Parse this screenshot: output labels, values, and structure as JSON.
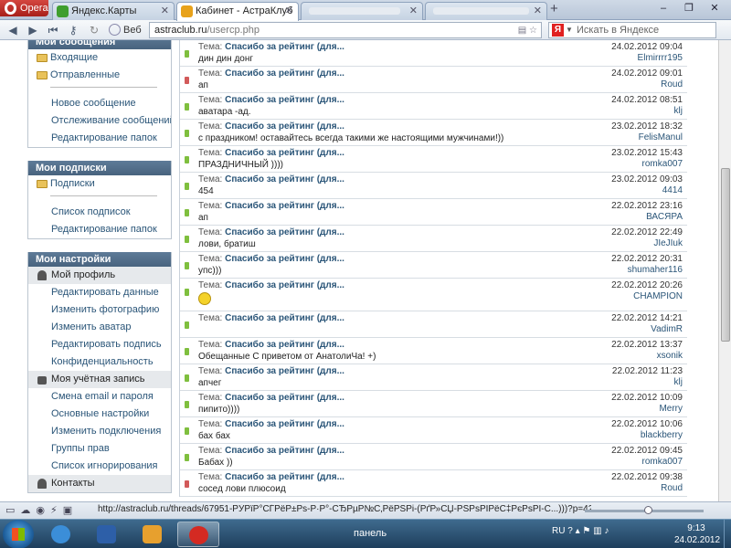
{
  "browser": {
    "menu_label": "Opera",
    "tabs": [
      {
        "title": "Яндекс.Карты",
        "active": false,
        "icon_color": "#3f9e2e"
      },
      {
        "title": "Кабинет - АстраКлуб",
        "active": true,
        "icon_color": "#e8a21a"
      },
      {
        "title": "",
        "active": false,
        "icon_color": ""
      },
      {
        "title": "",
        "active": false,
        "icon_color": ""
      }
    ],
    "window_controls": [
      "–",
      "❐",
      "✕"
    ],
    "address": {
      "prefix": "Веб",
      "domain": "astraclub.ru",
      "path": "/usercp.php"
    },
    "search": {
      "engine": "Я",
      "placeholder": "Искать в Яндексе"
    },
    "status_url": "http://astraclub.ru/threads/67951-РЎРїР°СЃРёР±Рѕ-Р·Р°-СЂРµР№С‚РёРЅРі-(РґР»СЏ-РЅРѕРІРёС‡РєРѕРІ-С...)))?p=4211641#pos..."
  },
  "sidebar": {
    "messages": {
      "title": "Мои сообщения",
      "folders": [
        "Входящие",
        "Отправленные"
      ],
      "links": [
        "Новое сообщение",
        "Отслеживание сообщений",
        "Редактирование папок"
      ]
    },
    "subscriptions": {
      "title": "Мои подписки",
      "folders": [
        "Подписки"
      ],
      "links": [
        "Список подписок",
        "Редактирование папок"
      ]
    },
    "settings": {
      "title": "Мои настройки",
      "profile_head": "Мой профиль",
      "profile_links": [
        "Редактировать данные",
        "Изменить фотографию",
        "Изменить аватар",
        "Редактировать подпись",
        "Конфиденциальность"
      ],
      "account_head": "Моя учётная запись",
      "account_links": [
        "Смена email и пароля",
        "Основные настройки",
        "Изменить подключения",
        "Группы прав",
        "Список игнорирования"
      ],
      "contacts_head": "Контакты"
    }
  },
  "posts": {
    "subject_prefix": "Тема:",
    "subject_title": "Спасибо за рейтинг (для...",
    "rows": [
      {
        "preview": "дин дин донг",
        "date": "24.02.2012 09:04",
        "user": "Elmirrrr195",
        "status": "green"
      },
      {
        "preview": "ап",
        "date": "24.02.2012 09:01",
        "user": "Roud",
        "status": "red"
      },
      {
        "preview": "аватара -ад.",
        "date": "24.02.2012 08:51",
        "user": "klj",
        "status": "green"
      },
      {
        "preview": "с праздником! оставайтесь всегда такими же настоящими мужчинами!))",
        "date": "23.02.2012 18:32",
        "user": "FelisManul",
        "status": "green"
      },
      {
        "preview": "ПРАЗДНИЧНЫЙ ))))",
        "date": "23.02.2012 15:43",
        "user": "romka007",
        "status": "green"
      },
      {
        "preview": "454",
        "date": "23.02.2012 09:03",
        "user": "4414",
        "status": "green"
      },
      {
        "preview": "ап",
        "date": "22.02.2012 23:16",
        "user": "ВАСЯРА",
        "status": "green"
      },
      {
        "preview": "лови, братиш",
        "date": "22.02.2012 22:49",
        "user": "JIeJIuk",
        "status": "green"
      },
      {
        "preview": "упс)))",
        "date": "22.02.2012 20:31",
        "user": "shumaher116",
        "status": "green"
      },
      {
        "preview": "",
        "date": "22.02.2012 20:26",
        "user": "CHAMPION",
        "status": "green",
        "smiley": true
      },
      {
        "preview": "",
        "date": "22.02.2012 14:21",
        "user": "VadimR",
        "status": "green"
      },
      {
        "preview": "Обещанные С приветом от АнатолиЧа! +)",
        "date": "22.02.2012 13:37",
        "user": "xsonik",
        "status": "green"
      },
      {
        "preview": "апчег",
        "date": "22.02.2012 11:23",
        "user": "klj",
        "status": "green"
      },
      {
        "preview": "пипито))))",
        "date": "22.02.2012 10:09",
        "user": "Merry",
        "status": "green"
      },
      {
        "preview": "бах бах",
        "date": "22.02.2012 10:06",
        "user": "blackberry",
        "status": "green"
      },
      {
        "preview": "Бабах ))",
        "date": "22.02.2012 09:45",
        "user": "romka007",
        "status": "green"
      },
      {
        "preview": "сосед лови плюсоид",
        "date": "22.02.2012 09:38",
        "user": "Roud",
        "status": "red"
      }
    ]
  },
  "taskbar": {
    "panel_label": "панель",
    "lang": "RU",
    "time": "9:13",
    "date": "24.02.2012"
  }
}
